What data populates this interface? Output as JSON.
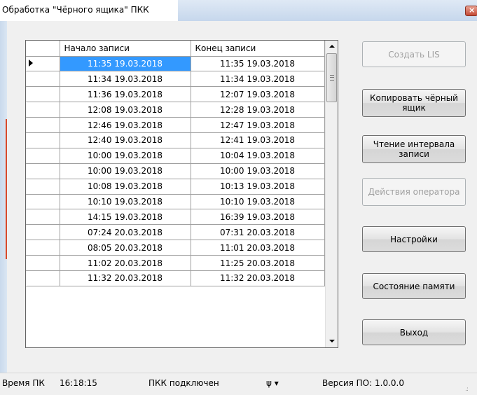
{
  "window": {
    "title": "Обработка \"Чёрного ящика\" ПКК"
  },
  "grid": {
    "columns": [
      "Начало записи",
      "Конец записи"
    ],
    "selected_row": 0,
    "rows": [
      [
        "11:35 19.03.2018",
        "11:35 19.03.2018"
      ],
      [
        "11:34 19.03.2018",
        "11:34 19.03.2018"
      ],
      [
        "11:36 19.03.2018",
        "12:07 19.03.2018"
      ],
      [
        "12:08 19.03.2018",
        "12:28 19.03.2018"
      ],
      [
        "12:46 19.03.2018",
        "12:47 19.03.2018"
      ],
      [
        "12:40 19.03.2018",
        "12:41 19.03.2018"
      ],
      [
        "10:00 19.03.2018",
        "10:04 19.03.2018"
      ],
      [
        "10:00 19.03.2018",
        "10:00 19.03.2018"
      ],
      [
        "10:08 19.03.2018",
        "10:13 19.03.2018"
      ],
      [
        "10:10 19.03.2018",
        "10:10 19.03.2018"
      ],
      [
        "14:15 19.03.2018",
        "16:39 19.03.2018"
      ],
      [
        "07:24 20.03.2018",
        "07:31 20.03.2018"
      ],
      [
        "08:05 20.03.2018",
        "11:01 20.03.2018"
      ],
      [
        "11:02 20.03.2018",
        "11:25 20.03.2018"
      ],
      [
        "11:32 20.03.2018",
        "11:32 20.03.2018"
      ]
    ]
  },
  "buttons": {
    "create_lis": "Создать LIS",
    "copy_black_box": "Копировать чёрный ящик",
    "read_interval": "Чтение интервала записи",
    "operator_actions": "Действия оператора",
    "settings": "Настройки",
    "memory_state": "Состояние памяти",
    "exit": "Выход"
  },
  "status": {
    "pc_time_label": "Время ПК",
    "pc_time": "16:18:15",
    "connection": "ПКК подключен",
    "usb_icon": "usb-icon",
    "version": "Версия ПО: 1.0.0.0"
  },
  "colors": {
    "selection": "#3399ff",
    "disabled_text": "#a0a0a0"
  }
}
